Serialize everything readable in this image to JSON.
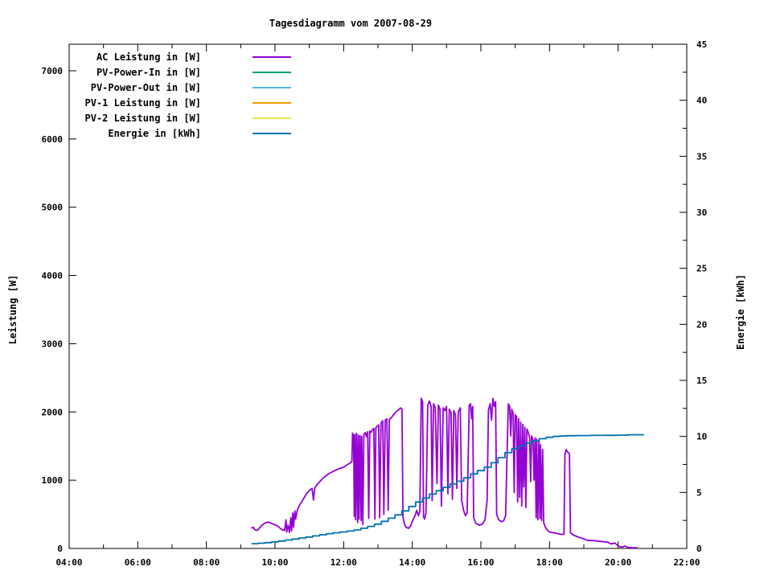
{
  "title": "Tagesdiagramm vom 2007-08-29",
  "axes": {
    "x": {
      "tick_labels": [
        "04:00",
        "06:00",
        "08:00",
        "10:00",
        "12:00",
        "14:00",
        "16:00",
        "18:00",
        "20:00",
        "22:00"
      ],
      "start_hour": 4,
      "end_hour": 22,
      "major_step_hours": 2,
      "minor_step_hours": 1
    },
    "y_left": {
      "label": "Leistung [W]",
      "ticks": [
        0,
        1000,
        2000,
        3000,
        4000,
        5000,
        6000,
        7000
      ]
    },
    "y_right": {
      "label": "Energie [kWh]",
      "ticks": [
        0,
        5,
        10,
        15,
        20,
        25,
        30,
        35,
        40,
        45
      ],
      "minor_step": 2.5
    }
  },
  "chart_data": {
    "type": "line",
    "title": "Tagesdiagramm vom 2007-08-29",
    "x_unit": "time of day (hours)",
    "x_range_hours": [
      4,
      22
    ],
    "y_left_label": "Leistung [W]",
    "y_left_range": [
      0,
      7400
    ],
    "y_right_label": "Energie [kWh]",
    "y_right_range": [
      0,
      45
    ],
    "grid": false,
    "legend_position": "top-left-inside",
    "series": [
      {
        "name": "AC Leistung in [W]",
        "color": "#9400d3",
        "axis": "left",
        "render": "line",
        "points": [
          [
            9.32,
            300
          ],
          [
            9.37,
            310
          ],
          [
            9.4,
            280
          ],
          [
            9.45,
            265
          ],
          [
            9.5,
            270
          ],
          [
            9.55,
            300
          ],
          [
            9.62,
            340
          ],
          [
            9.7,
            370
          ],
          [
            9.78,
            385
          ],
          [
            9.85,
            380
          ],
          [
            9.93,
            360
          ],
          [
            10,
            345
          ],
          [
            10.08,
            330
          ],
          [
            10.15,
            295
          ],
          [
            10.22,
            270
          ],
          [
            10.28,
            265
          ],
          [
            10.32,
            420
          ],
          [
            10.34,
            240
          ],
          [
            10.38,
            340
          ],
          [
            10.42,
            235
          ],
          [
            10.46,
            450
          ],
          [
            10.48,
            255
          ],
          [
            10.52,
            520
          ],
          [
            10.54,
            310
          ],
          [
            10.58,
            550
          ],
          [
            10.6,
            430
          ],
          [
            10.65,
            560
          ],
          [
            10.72,
            640
          ],
          [
            10.8,
            700
          ],
          [
            10.9,
            790
          ],
          [
            11,
            850
          ],
          [
            11.08,
            880
          ],
          [
            11.12,
            710
          ],
          [
            11.16,
            890
          ],
          [
            11.25,
            950
          ],
          [
            11.4,
            1030
          ],
          [
            11.55,
            1090
          ],
          [
            11.7,
            1130
          ],
          [
            11.85,
            1165
          ],
          [
            12,
            1190
          ],
          [
            12.1,
            1225
          ],
          [
            12.2,
            1255
          ],
          [
            12.24,
            1280
          ],
          [
            12.26,
            1690
          ],
          [
            12.29,
            1650
          ],
          [
            12.31,
            470
          ],
          [
            12.33,
            1670
          ],
          [
            12.35,
            420
          ],
          [
            12.38,
            1690
          ],
          [
            12.41,
            380
          ],
          [
            12.43,
            1660
          ],
          [
            12.45,
            430
          ],
          [
            12.48,
            1650
          ],
          [
            12.51,
            410
          ],
          [
            12.53,
            1640
          ],
          [
            12.56,
            350
          ],
          [
            12.59,
            1670
          ],
          [
            12.63,
            1700
          ],
          [
            12.66,
            1640
          ],
          [
            12.7,
            1710
          ],
          [
            12.73,
            440
          ],
          [
            12.76,
            1720
          ],
          [
            12.8,
            1700
          ],
          [
            12.84,
            1740
          ],
          [
            12.88,
            1760
          ],
          [
            12.91,
            430
          ],
          [
            12.94,
            1770
          ],
          [
            12.98,
            1790
          ],
          [
            13.02,
            1810
          ],
          [
            13.05,
            450
          ],
          [
            13.09,
            1840
          ],
          [
            13.14,
            1870
          ],
          [
            13.17,
            500
          ],
          [
            13.21,
            1880
          ],
          [
            13.26,
            1900
          ],
          [
            13.3,
            560
          ],
          [
            13.33,
            1890
          ],
          [
            13.38,
            1910
          ],
          [
            13.44,
            1950
          ],
          [
            13.52,
            2000
          ],
          [
            13.6,
            2030
          ],
          [
            13.66,
            2060
          ],
          [
            13.7,
            2040
          ],
          [
            13.73,
            460
          ],
          [
            13.77,
            360
          ],
          [
            13.82,
            310
          ],
          [
            13.89,
            295
          ],
          [
            13.95,
            330
          ],
          [
            14.02,
            420
          ],
          [
            14.08,
            480
          ],
          [
            14.13,
            560
          ],
          [
            14.18,
            480
          ],
          [
            14.22,
            540
          ],
          [
            14.26,
            2200
          ],
          [
            14.3,
            2150
          ],
          [
            14.33,
            460
          ],
          [
            14.36,
            430
          ],
          [
            14.4,
            520
          ],
          [
            14.45,
            2100
          ],
          [
            14.5,
            2160
          ],
          [
            14.55,
            2080
          ],
          [
            14.58,
            700
          ],
          [
            14.62,
            2120
          ],
          [
            14.67,
            2060
          ],
          [
            14.72,
            950
          ],
          [
            14.76,
            2100
          ],
          [
            14.81,
            2040
          ],
          [
            14.85,
            620
          ],
          [
            14.9,
            2060
          ],
          [
            14.95,
            2020
          ],
          [
            15,
            2080
          ],
          [
            15.04,
            800
          ],
          [
            15.08,
            2040
          ],
          [
            15.13,
            1990
          ],
          [
            15.17,
            720
          ],
          [
            15.21,
            2020
          ],
          [
            15.26,
            1960
          ],
          [
            15.3,
            880
          ],
          [
            15.34,
            2000
          ],
          [
            15.4,
            2060
          ],
          [
            15.44,
            700
          ],
          [
            15.5,
            550
          ],
          [
            15.55,
            480
          ],
          [
            15.6,
            520
          ],
          [
            15.66,
            2100
          ],
          [
            15.7,
            2120
          ],
          [
            15.73,
            1900
          ],
          [
            15.76,
            2080
          ],
          [
            15.79,
            450
          ],
          [
            15.85,
            370
          ],
          [
            15.95,
            340
          ],
          [
            16.05,
            360
          ],
          [
            16.12,
            420
          ],
          [
            16.18,
            700
          ],
          [
            16.22,
            2030
          ],
          [
            16.27,
            2120
          ],
          [
            16.31,
            1880
          ],
          [
            16.35,
            2200
          ],
          [
            16.39,
            2080
          ],
          [
            16.43,
            2150
          ],
          [
            16.46,
            500
          ],
          [
            16.52,
            420
          ],
          [
            16.6,
            390
          ],
          [
            16.67,
            410
          ],
          [
            16.72,
            480
          ],
          [
            16.8,
            2120
          ],
          [
            16.84,
            2080
          ],
          [
            16.87,
            1650
          ],
          [
            16.9,
            2040
          ],
          [
            16.94,
            1980
          ],
          [
            16.97,
            820
          ],
          [
            17,
            1960
          ],
          [
            17.04,
            1930
          ],
          [
            17.07,
            680
          ],
          [
            17.1,
            1900
          ],
          [
            17.13,
            750
          ],
          [
            17.16,
            1850
          ],
          [
            17.19,
            620
          ],
          [
            17.22,
            1820
          ],
          [
            17.25,
            900
          ],
          [
            17.28,
            1780
          ],
          [
            17.31,
            600
          ],
          [
            17.34,
            1750
          ],
          [
            17.38,
            1700
          ],
          [
            17.42,
            1620
          ],
          [
            17.45,
            980
          ],
          [
            17.48,
            1650
          ],
          [
            17.52,
            1580
          ],
          [
            17.55,
            1000
          ],
          [
            17.58,
            1620
          ],
          [
            17.61,
            450
          ],
          [
            17.63,
            1600
          ],
          [
            17.66,
            420
          ],
          [
            17.69,
            1580
          ],
          [
            17.72,
            440
          ],
          [
            17.74,
            1520
          ],
          [
            17.77,
            410
          ],
          [
            17.8,
            1450
          ],
          [
            17.83,
            380
          ],
          [
            17.87,
            320
          ],
          [
            17.92,
            280
          ],
          [
            17.98,
            245
          ],
          [
            18.05,
            235
          ],
          [
            18.15,
            228
          ],
          [
            18.25,
            215
          ],
          [
            18.35,
            205
          ],
          [
            18.42,
            210
          ],
          [
            18.45,
            1380
          ],
          [
            18.49,
            1450
          ],
          [
            18.53,
            1410
          ],
          [
            18.58,
            1390
          ],
          [
            18.61,
            230
          ],
          [
            18.7,
            195
          ],
          [
            18.85,
            165
          ],
          [
            19,
            140
          ],
          [
            19.1,
            120
          ],
          [
            19.25,
            115
          ],
          [
            19.4,
            108
          ],
          [
            19.55,
            100
          ],
          [
            19.7,
            90
          ],
          [
            19.8,
            65
          ],
          [
            19.9,
            80
          ],
          [
            20,
            40
          ],
          [
            20.05,
            25
          ],
          [
            20.12,
            20
          ],
          [
            20.2,
            35
          ],
          [
            20.28,
            15
          ],
          [
            20.4,
            12
          ],
          [
            20.55,
            10
          ]
        ]
      },
      {
        "name": "PV-Power-In in [W]",
        "color": "#009e73",
        "axis": "left",
        "render": "line",
        "points": []
      },
      {
        "name": "PV-Power-Out in [W]",
        "color": "#56b4e9",
        "axis": "left",
        "render": "line",
        "points": []
      },
      {
        "name": "PV-1 Leistung in [W]",
        "color": "#e69f00",
        "axis": "left",
        "render": "line",
        "points": []
      },
      {
        "name": "PV-2 Leistung in [W]",
        "color": "#f0e442",
        "axis": "left",
        "render": "line",
        "points": []
      },
      {
        "name": "Energie in [kWh]",
        "color": "#0072b2",
        "axis": "right",
        "render": "steps",
        "points": [
          [
            9.33,
            0.42
          ],
          [
            9.5,
            0.47
          ],
          [
            9.7,
            0.52
          ],
          [
            9.9,
            0.58
          ],
          [
            10.1,
            0.66
          ],
          [
            10.3,
            0.75
          ],
          [
            10.5,
            0.84
          ],
          [
            10.7,
            0.93
          ],
          [
            10.9,
            1.02
          ],
          [
            11.1,
            1.12
          ],
          [
            11.3,
            1.22
          ],
          [
            11.5,
            1.32
          ],
          [
            11.7,
            1.4
          ],
          [
            11.9,
            1.47
          ],
          [
            12.1,
            1.55
          ],
          [
            12.3,
            1.65
          ],
          [
            12.5,
            1.8
          ],
          [
            12.7,
            1.97
          ],
          [
            12.9,
            2.17
          ],
          [
            13.1,
            2.42
          ],
          [
            13.3,
            2.7
          ],
          [
            13.5,
            3.0
          ],
          [
            13.7,
            3.35
          ],
          [
            13.9,
            3.75
          ],
          [
            14.1,
            4.15
          ],
          [
            14.3,
            4.5
          ],
          [
            14.5,
            4.85
          ],
          [
            14.7,
            5.15
          ],
          [
            14.9,
            5.45
          ],
          [
            15.1,
            5.75
          ],
          [
            15.3,
            6.0
          ],
          [
            15.5,
            6.3
          ],
          [
            15.7,
            6.65
          ],
          [
            15.9,
            6.95
          ],
          [
            16.1,
            7.25
          ],
          [
            16.3,
            7.65
          ],
          [
            16.5,
            8.1
          ],
          [
            16.7,
            8.55
          ],
          [
            16.9,
            8.9
          ],
          [
            17.1,
            9.15
          ],
          [
            17.3,
            9.4
          ],
          [
            17.5,
            9.6
          ],
          [
            17.7,
            9.8
          ],
          [
            17.9,
            9.92
          ],
          [
            18.1,
            10.0
          ],
          [
            18.3,
            10.03
          ],
          [
            18.5,
            10.06
          ],
          [
            18.8,
            10.08
          ],
          [
            19.2,
            10.09
          ],
          [
            19.6,
            10.1
          ],
          [
            20.0,
            10.11
          ],
          [
            20.3,
            10.15
          ],
          [
            20.74,
            10.15
          ]
        ]
      }
    ]
  }
}
